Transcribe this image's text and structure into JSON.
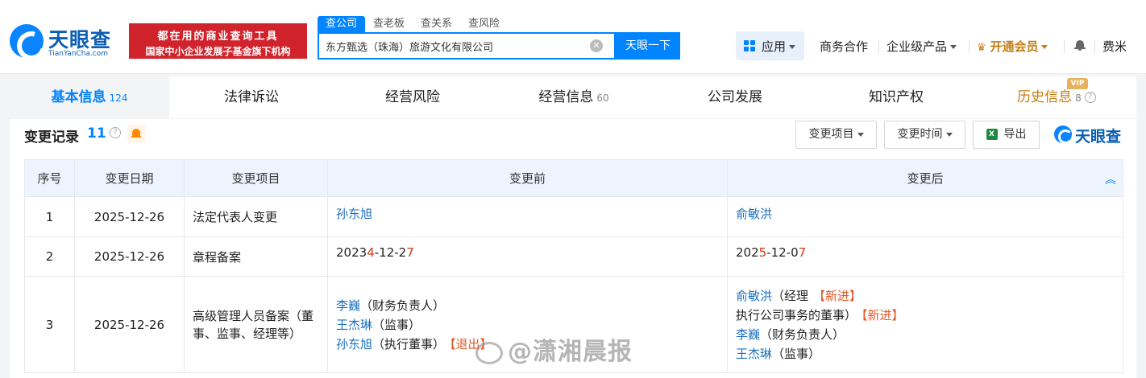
{
  "header": {
    "logo_text": "天眼查",
    "logo_sub": "TianYanCha.com",
    "promo_line1": "都在用的商业查询工具",
    "promo_line2": "国家中小企业发展子基金旗下机构",
    "search_tabs": [
      "查公司",
      "查老板",
      "查关系",
      "查风险"
    ],
    "search_value": "东方甄选（珠海）旅游文化有限公司",
    "search_button": "天眼一下",
    "app_label": "应用",
    "nav": {
      "business": "商务合作",
      "enterprise": "企业级产品",
      "vip": "开通会员",
      "user": "费米"
    }
  },
  "tabs": {
    "basic": {
      "label": "基本信息",
      "count": "124"
    },
    "legal": {
      "label": "法律诉讼"
    },
    "risk": {
      "label": "经营风险"
    },
    "info": {
      "label": "经营信息",
      "count": "60"
    },
    "develop": {
      "label": "公司发展"
    },
    "ip": {
      "label": "知识产权"
    },
    "history": {
      "label": "历史信息",
      "count": "8",
      "badge": "VIP"
    }
  },
  "section": {
    "title": "变更记录",
    "count": "11",
    "filter_item": "变更项目",
    "filter_time": "变更时间",
    "export": "导出",
    "brand": "天眼查"
  },
  "table": {
    "headers": [
      "序号",
      "变更日期",
      "变更项目",
      "变更前",
      "变更后"
    ],
    "rows": [
      {
        "no": "1",
        "date": "2025-12-26",
        "item": "法定代表人变更",
        "before_name": "孙东旭",
        "after_name": "俞敏洪"
      },
      {
        "no": "2",
        "date": "2025-12-26",
        "item": "章程备案",
        "before_pre": "2023",
        "before_hl1": "4",
        "before_mid": "-12-2",
        "before_hl2": "7",
        "after_pre": "202",
        "after_hl1": "5",
        "after_mid": "-12-0",
        "after_hl2": "7"
      },
      {
        "no": "3",
        "date": "2025-12-26",
        "item": "高级管理人员备案（董事、监事、经理等）",
        "before": [
          {
            "name": "李巍",
            "role": "（财务负责人）"
          },
          {
            "name": "王杰琳",
            "role": "（监事）"
          },
          {
            "name": "孙东旭",
            "role": "（执行董事）",
            "tag": "【退出】"
          }
        ],
        "after": [
          {
            "name": "俞敏洪",
            "role": "（经理",
            "tag": "【新进】"
          },
          {
            "name": "",
            "role": "执行公司事务的董事）",
            "tag": "【新进】"
          },
          {
            "name": "李巍",
            "role": "（财务负责人）"
          },
          {
            "name": "王杰琳",
            "role": "（监事）"
          }
        ]
      }
    ]
  },
  "watermark": "@潇湘晨报"
}
